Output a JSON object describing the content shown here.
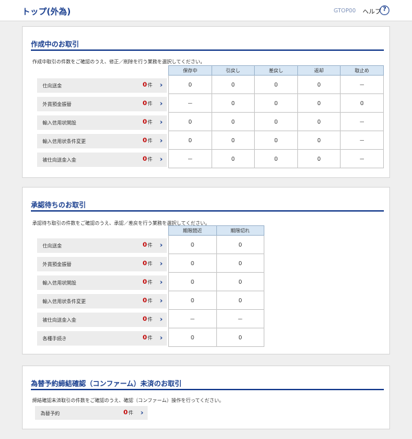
{
  "header": {
    "title": "トップ(外為)",
    "screen_id": "GTOP00",
    "help_label": "ヘルプ",
    "help_icon_glyph": "?"
  },
  "icons": {
    "row_arrow": "chevron-right-icon",
    "help": "question-circle-icon"
  },
  "colors": {
    "accent": "#1a3f8f",
    "count": "#c00000",
    "header_cell": "#d7e6f4"
  },
  "count_unit": "件",
  "in_progress": {
    "title": "作成中のお取引",
    "description": "作成中取引の件数をご確認のうえ、修正／削除を行う業務を選択してください。",
    "columns": [
      "保存中",
      "引戻し",
      "差戻し",
      "返却",
      "取止め"
    ],
    "rows": [
      {
        "label": "仕向送金",
        "count": "0",
        "cells": [
          "0",
          "0",
          "0",
          "0",
          "－"
        ]
      },
      {
        "label": "外貨預金振替",
        "count": "0",
        "cells": [
          "－",
          "0",
          "0",
          "0",
          "0"
        ]
      },
      {
        "label": "輸入信用状開設",
        "count": "0",
        "cells": [
          "0",
          "0",
          "0",
          "0",
          "－"
        ]
      },
      {
        "label": "輸入信用状条件変更",
        "count": "0",
        "cells": [
          "0",
          "0",
          "0",
          "0",
          "－"
        ]
      },
      {
        "label": "被仕向送金入金",
        "count": "0",
        "cells": [
          "－",
          "0",
          "0",
          "0",
          "－"
        ]
      }
    ]
  },
  "pending_approval": {
    "title": "承認待ちのお取引",
    "description": "承認待ち取引の件数をご確認のうえ、承認／差戻を行う業務を選択してください。",
    "columns": [
      "期限間近",
      "期限切れ"
    ],
    "rows": [
      {
        "label": "仕向送金",
        "count": "0",
        "cells": [
          "0",
          "0"
        ]
      },
      {
        "label": "外貨預金振替",
        "count": "0",
        "cells": [
          "0",
          "0"
        ]
      },
      {
        "label": "輸入信用状開設",
        "count": "0",
        "cells": [
          "0",
          "0"
        ]
      },
      {
        "label": "輸入信用状条件変更",
        "count": "0",
        "cells": [
          "0",
          "0"
        ]
      },
      {
        "label": "被仕向送金入金",
        "count": "0",
        "cells": [
          "－",
          "－"
        ]
      },
      {
        "label": "各種手続き",
        "count": "0",
        "cells": [
          "0",
          "0"
        ]
      }
    ]
  },
  "unconfirmed": {
    "title": "為替予約締結確認（コンファーム）未済のお取引",
    "description": "締結確認未済取引の件数をご確認のうえ、確認（コンファーム）操作を行ってください。",
    "rows": [
      {
        "label": "為替予約",
        "count": "0"
      }
    ]
  }
}
